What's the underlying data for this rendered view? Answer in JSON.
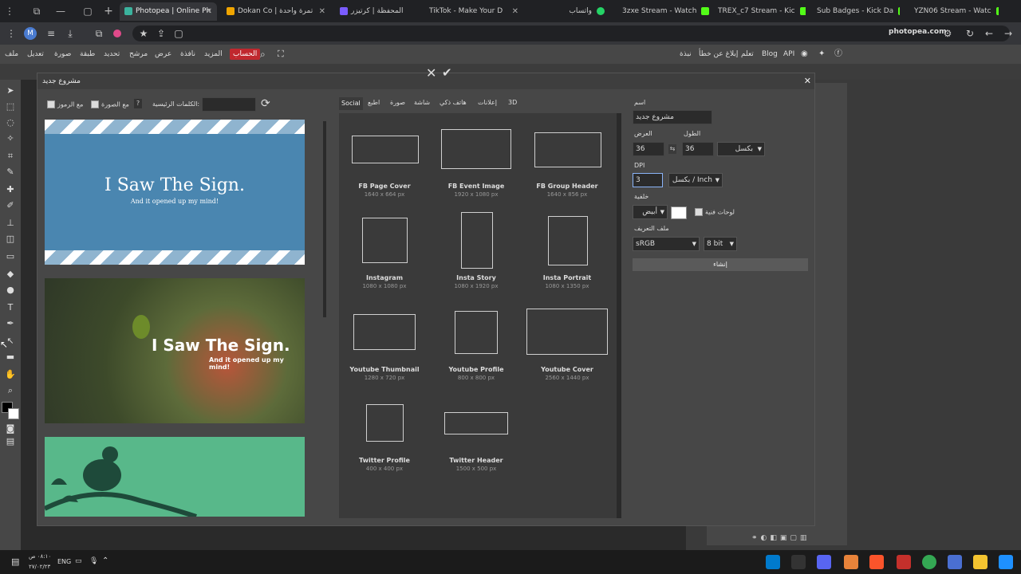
{
  "browser": {
    "tabs": [
      {
        "label": "Photopea | Online Ph",
        "color": "#3bb39e",
        "active": true
      },
      {
        "label": "Dokan Co | تمرة واحدة",
        "color": "#f0a500"
      },
      {
        "label": "المحفظة | كرتيزر",
        "color": "#7a5cff"
      },
      {
        "label": "TikTok - Make Your D",
        "color": "#ffffff"
      },
      {
        "label": "واتساب",
        "color": "#25d366"
      },
      {
        "label": "3zxe Stream - Watch",
        "color": "#53fc18"
      },
      {
        "label": "TREX_c7 Stream - Kic",
        "color": "#53fc18"
      },
      {
        "label": "Sub Badges - Kick Da",
        "color": "#53fc18"
      },
      {
        "label": "YZN06 Stream - Watc",
        "color": "#53fc18"
      }
    ],
    "new_tab": "+",
    "domain": "photopea.com"
  },
  "menu": {
    "items_rtl": [
      "ملف",
      "تعديل",
      "صورة",
      "طبقة",
      "تحديد",
      "مرشح",
      "عرض",
      "نافذة",
      "المزيد"
    ],
    "account": "الحساب",
    "right_links": [
      "API",
      "Blog",
      "تعلم",
      "إبلاغ عن خطأ",
      "نبذة"
    ]
  },
  "dialog": {
    "title": "مشروع جديد",
    "filters": {
      "symbols": "مع الرموز",
      "image": "مع الصورة",
      "help": "?",
      "keywords_label": "الكلمات الرئيسية:",
      "keywords_value": ""
    },
    "thumbs": {
      "t1_title": "I Saw The Sign.",
      "t1_sub": "And it opened up my mind!",
      "t2_title": "I Saw The Sign.",
      "t2_sub": "And it opened up my mind!"
    },
    "categories": [
      "Social",
      "اطبع",
      "صورة",
      "شاشة",
      "هاتف ذكي",
      "إعلانات",
      "3D"
    ],
    "presets": [
      {
        "name": "FB Page Cover",
        "size": "1640 x 664 px"
      },
      {
        "name": "FB Event Image",
        "size": "1920 x 1080 px"
      },
      {
        "name": "FB Group Header",
        "size": "1640 x 856 px"
      },
      {
        "name": "Instagram",
        "size": "1080 x 1080 px"
      },
      {
        "name": "Insta Story",
        "size": "1080 x 1920 px"
      },
      {
        "name": "Insta Portrait",
        "size": "1080 x 1350 px"
      },
      {
        "name": "Youtube Thumbnail",
        "size": "1280 x 720 px"
      },
      {
        "name": "Youtube Profile",
        "size": "800 x 800 px"
      },
      {
        "name": "Youtube Cover",
        "size": "2560 x 1440 px"
      },
      {
        "name": "Twitter Profile",
        "size": "400 x 400 px"
      },
      {
        "name": "Twitter Header",
        "size": "1500 x 500 px"
      }
    ],
    "form": {
      "name_label": "اسم",
      "name_value": "مشروع جديد",
      "width_label": "العرض",
      "height_label": "الطول",
      "width_value": "36",
      "height_value": "36",
      "unit": "بكسل",
      "dpi_label": "DPI",
      "dpi_value": "3",
      "dpi_unit": "بكسل / Inch",
      "bg_label": "خلفية",
      "bg_value": "أبيض",
      "artboards": "لوحات فنية",
      "profile_label": "ملف التعريف",
      "profile_value": "sRGB",
      "bits_value": "8 bit",
      "create_button": "إنشاء"
    }
  },
  "taskbar": {
    "lang": "ENG",
    "time": "٠٨:١٠ ص",
    "date": "٢٧/٠٢/٢٣"
  }
}
